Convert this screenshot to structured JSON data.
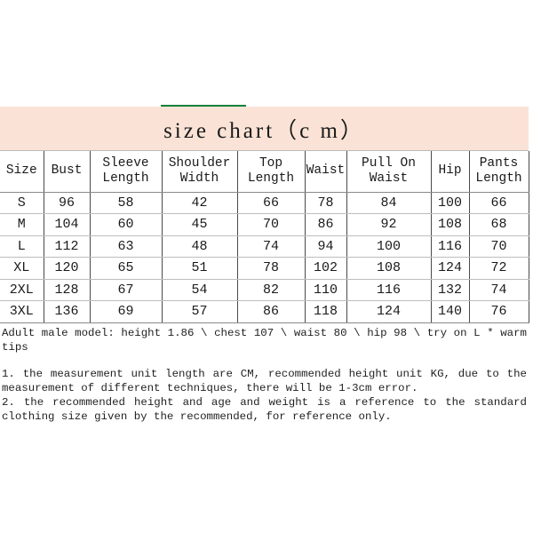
{
  "banner": {
    "title": "size chart（c m）",
    "background_color": "#fae3d6",
    "accent_color": "#12803a"
  },
  "chart_data": {
    "type": "table",
    "title": "size chart（c m）",
    "columns": [
      "Size",
      "Bust",
      "Sleeve Length",
      "Shoulder Width",
      "Top Length",
      "Waist",
      "Pull On Waist",
      "Hip",
      "Pants Length"
    ],
    "column_labels_multiline": [
      [
        "Size"
      ],
      [
        "Bust"
      ],
      [
        "Sleeve",
        "Length"
      ],
      [
        "Shoulder",
        "Width"
      ],
      [
        "Top",
        "Length"
      ],
      [
        "Waist"
      ],
      [
        "Pull On",
        "Waist"
      ],
      [
        "Hip"
      ],
      [
        "Pants",
        "Length"
      ]
    ],
    "unit": "cm",
    "rows": [
      [
        "S",
        "96",
        "58",
        "42",
        "66",
        "78",
        "84",
        "100",
        "66"
      ],
      [
        "M",
        "104",
        "60",
        "45",
        "70",
        "86",
        "92",
        "108",
        "68"
      ],
      [
        "L",
        "112",
        "63",
        "48",
        "74",
        "94",
        "100",
        "116",
        "70"
      ],
      [
        "XL",
        "120",
        "65",
        "51",
        "78",
        "102",
        "108",
        "124",
        "72"
      ],
      [
        "2XL",
        "128",
        "67",
        "54",
        "82",
        "110",
        "116",
        "132",
        "74"
      ],
      [
        "3XL",
        "136",
        "69",
        "57",
        "86",
        "118",
        "124",
        "140",
        "76"
      ]
    ]
  },
  "notes": {
    "model": "Adult male model: height 1.86 \\ chest 107 \\ waist 80 \\ hip 98 \\ try on L * warm tips",
    "items": [
      "1. the measurement unit length are CM, recommended height unit KG, due to the measurement of different techniques, there will be 1-3cm error.",
      "2. the recommended height and age and weight is a reference to the standard clothing size given by the recommended, for reference only."
    ]
  }
}
